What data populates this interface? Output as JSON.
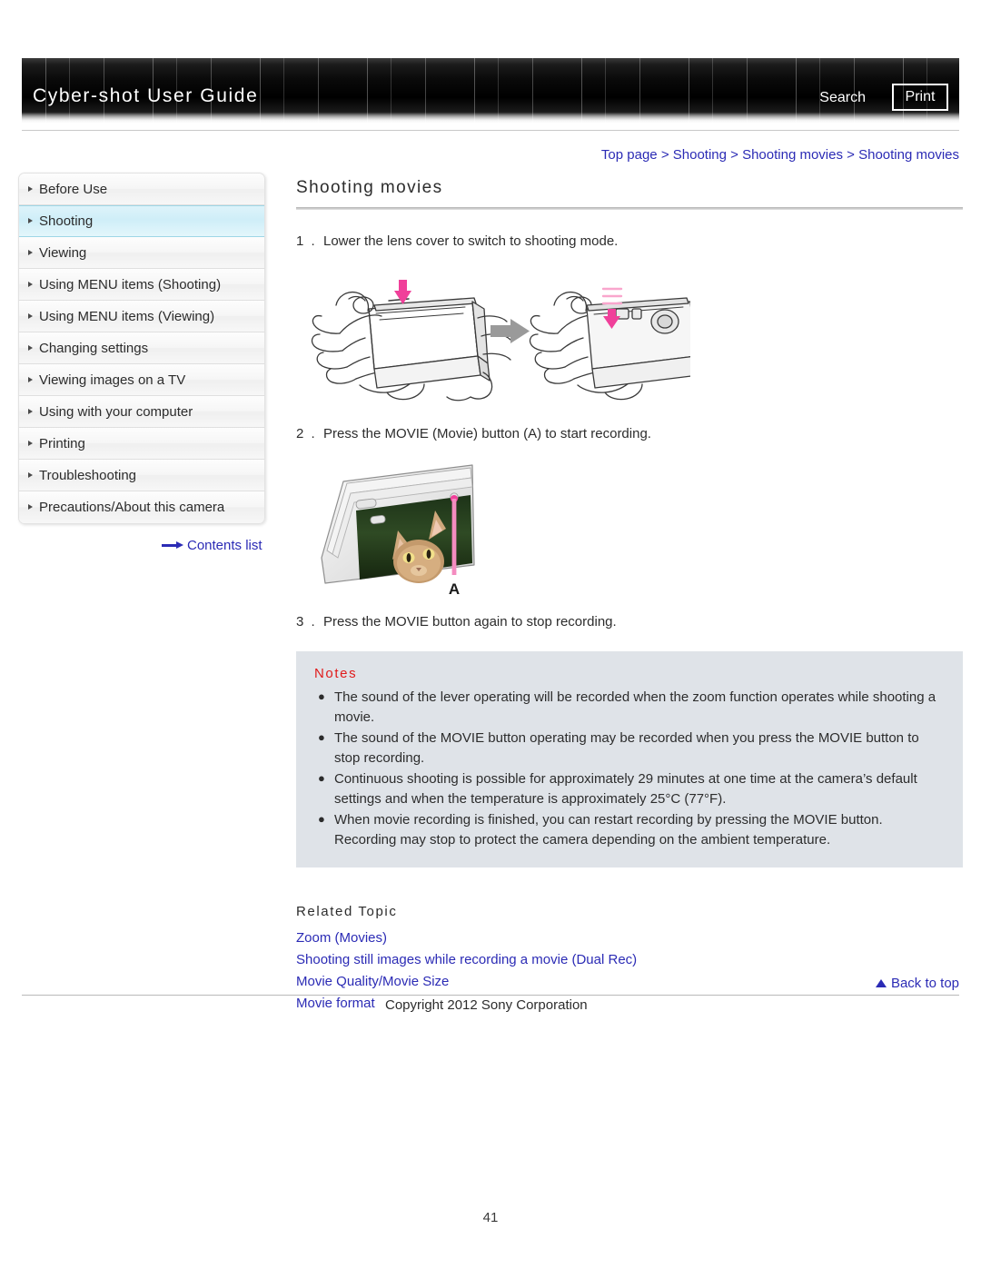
{
  "header": {
    "title": "Cyber-shot User Guide",
    "search_label": "Search",
    "print_label": "Print"
  },
  "breadcrumb": {
    "separator": ">",
    "items": [
      {
        "label": "Top page"
      },
      {
        "label": "Shooting"
      },
      {
        "label": "Shooting movies"
      },
      {
        "label": "Shooting movies"
      }
    ]
  },
  "sidebar": {
    "items": [
      {
        "label": "Before Use",
        "selected": false
      },
      {
        "label": "Shooting",
        "selected": true
      },
      {
        "label": "Viewing",
        "selected": false
      },
      {
        "label": "Using MENU items (Shooting)",
        "selected": false
      },
      {
        "label": "Using MENU items (Viewing)",
        "selected": false
      },
      {
        "label": "Changing settings",
        "selected": false
      },
      {
        "label": "Viewing images on a TV",
        "selected": false
      },
      {
        "label": "Using with your computer",
        "selected": false
      },
      {
        "label": "Printing",
        "selected": false
      },
      {
        "label": "Troubleshooting",
        "selected": false
      },
      {
        "label": "Precautions/About this camera",
        "selected": false
      }
    ],
    "contents_list_label": "Contents list"
  },
  "main": {
    "title": "Shooting movies",
    "steps": [
      {
        "num": "1 .",
        "text": "Lower the lens cover to switch to shooting mode."
      },
      {
        "num": "2 .",
        "text": "Press the MOVIE (Movie) button (A) to start recording."
      },
      {
        "num": "3 .",
        "text": "Press the MOVIE button again to stop recording."
      }
    ],
    "figure_movie_button_label": "A",
    "notes": {
      "heading": "Notes",
      "bullet": "●",
      "items": [
        "The sound of the lever operating will be recorded when the zoom function operates while shooting a movie.",
        "The sound of the MOVIE button operating may be recorded when you press the MOVIE button to stop recording.",
        "Continuous shooting is possible for approximately 29 minutes at one time at the camera’s default settings and when the temperature is approximately 25°C (77°F).",
        "When movie recording is finished, you can restart recording by pressing the MOVIE button. Recording may stop to protect the camera depending on the ambient temperature."
      ]
    },
    "related_topic": {
      "heading": "Related Topic",
      "links": [
        {
          "label": "Zoom (Movies)"
        },
        {
          "label": "Shooting still images while recording a movie (Dual Rec)"
        },
        {
          "label": "Movie Quality/Movie Size"
        },
        {
          "label": "Movie format"
        }
      ]
    }
  },
  "footer": {
    "back_to_top_label": "Back to top",
    "copyright": "Copyright 2012 Sony Corporation",
    "page_number": "41"
  },
  "colors": {
    "link": "#2b2bb5",
    "notes_heading": "#e01b1b",
    "notes_background": "#dfe3e8",
    "sidebar_selected": "#cfeef8",
    "arrow_pink": "#f0409a"
  }
}
